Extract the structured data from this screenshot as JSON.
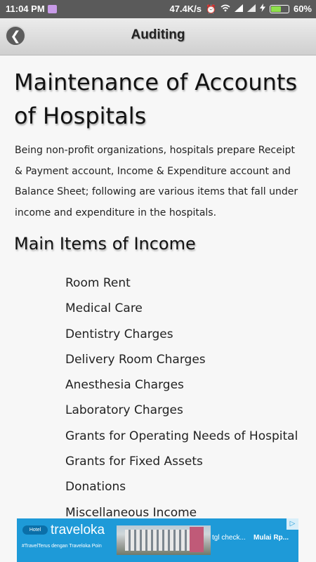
{
  "status_bar": {
    "time": "11:04 PM",
    "network_speed": "47.4K/s",
    "battery_percent": "60%",
    "battery_level": 0.6,
    "icons": [
      "notification-icon",
      "alarm-icon",
      "wifi-icon",
      "signal-icon",
      "signal-icon-2",
      "charging-icon",
      "battery-icon"
    ]
  },
  "app_bar": {
    "title": "Auditing",
    "back_icon": "chevron-left-icon"
  },
  "article": {
    "title": "Maintenance of Accounts of Hospitals",
    "intro": "Being non-profit organizations, hospitals prepare Receipt & Payment account, Income & Expenditure account and Balance Sheet; following are various items that fall under income and expenditure in the hospitals.",
    "section_heading": "Main Items of Income",
    "income_items": [
      "Room Rent",
      "Medical Care",
      "Dentistry Charges",
      "Delivery Room Charges",
      "Anesthesia Charges",
      "Laboratory Charges",
      "Grants for Operating Needs of Hospital",
      "Grants for Fixed Assets",
      "Donations",
      "Miscellaneous Income"
    ]
  },
  "ad": {
    "badge": "Hotel",
    "brand": "traveloka",
    "tagline": "#TravelTerus dengan Traveloka Poin",
    "text_1": "tgl check...",
    "text_2": "Mulai Rp...",
    "colors": {
      "background": "#1e9ad8"
    }
  },
  "colors": {
    "status_bar": "#5a5a5a",
    "battery_fill": "#8ee04c",
    "app_bar": "#dcdcdc",
    "page_background": "#f7f7f7"
  }
}
